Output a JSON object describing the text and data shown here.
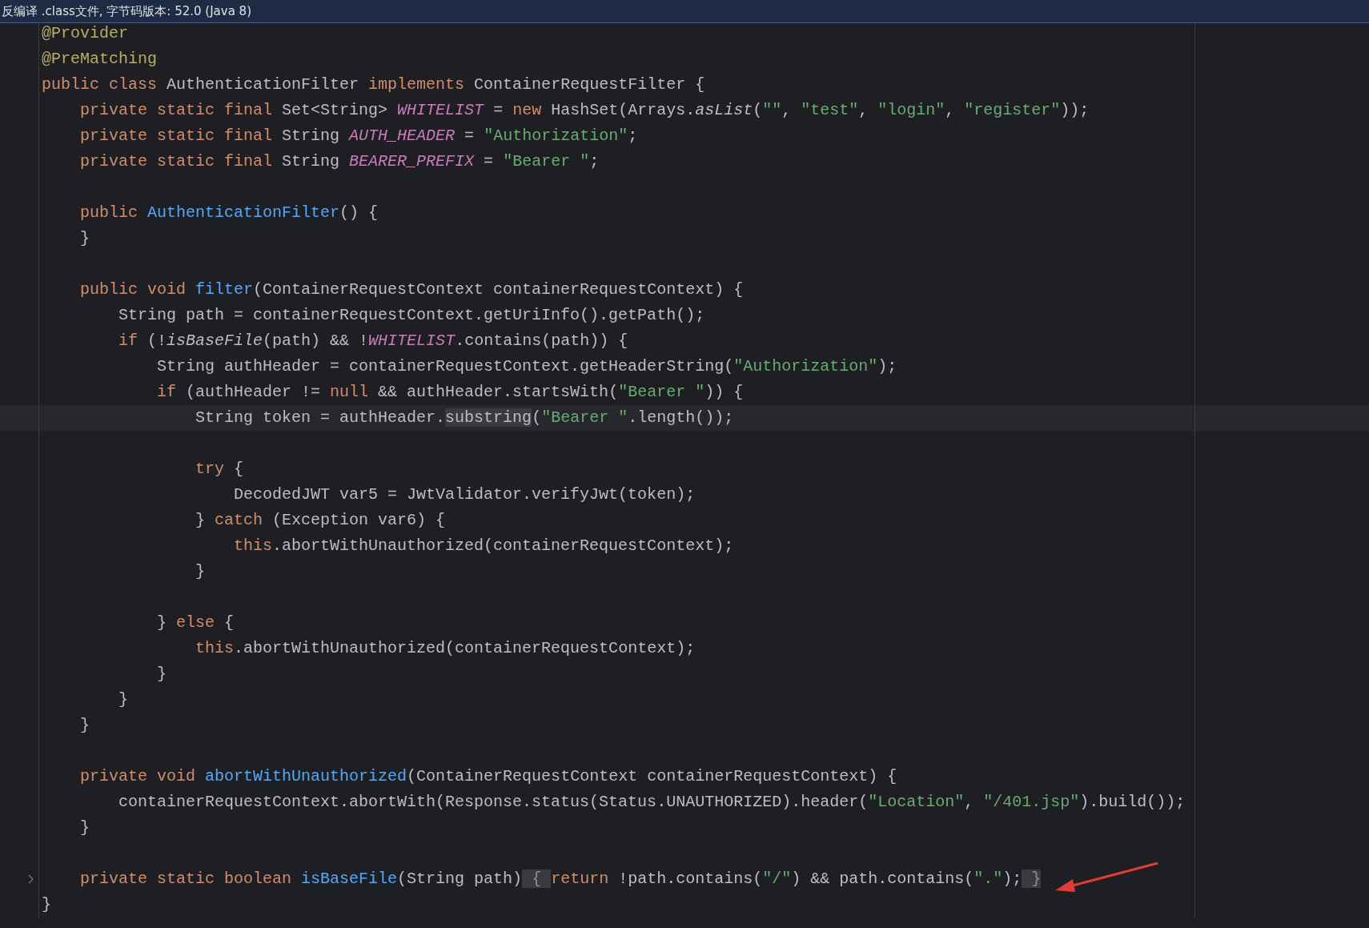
{
  "top_bar": {
    "text": "反编译 .class文件, 字节码版本: 52.0 (Java 8)"
  },
  "lines": [
    {
      "kind": "code",
      "current": false,
      "folded": false,
      "tokens": [
        {
          "kind": "annotation",
          "text": "@Provider"
        }
      ]
    },
    {
      "kind": "code",
      "current": false,
      "folded": false,
      "tokens": [
        {
          "kind": "annotation",
          "text": "@PreMatching"
        }
      ]
    },
    {
      "kind": "code",
      "current": false,
      "folded": false,
      "tokens": [
        {
          "kind": "keyword",
          "text": "public class "
        },
        {
          "kind": "plain",
          "text": "AuthenticationFilter "
        },
        {
          "kind": "keyword",
          "text": "implements "
        },
        {
          "kind": "plain",
          "text": "ContainerRequestFilter {"
        }
      ]
    },
    {
      "kind": "code",
      "current": false,
      "folded": false,
      "tokens": [
        {
          "kind": "keyword",
          "text": "    private static final "
        },
        {
          "kind": "plain",
          "text": "Set<String> "
        },
        {
          "kind": "field",
          "text": "WHITELIST"
        },
        {
          "kind": "plain",
          "text": " = "
        },
        {
          "kind": "keyword",
          "text": "new "
        },
        {
          "kind": "plain",
          "text": "HashSet(Arrays."
        },
        {
          "kind": "static",
          "text": "asList"
        },
        {
          "kind": "plain",
          "text": "("
        },
        {
          "kind": "string",
          "text": "\"\""
        },
        {
          "kind": "plain",
          "text": ", "
        },
        {
          "kind": "string",
          "text": "\"test\""
        },
        {
          "kind": "plain",
          "text": ", "
        },
        {
          "kind": "string",
          "text": "\"login\""
        },
        {
          "kind": "plain",
          "text": ", "
        },
        {
          "kind": "string",
          "text": "\"register\""
        },
        {
          "kind": "plain",
          "text": "));"
        }
      ]
    },
    {
      "kind": "code",
      "current": false,
      "folded": false,
      "tokens": [
        {
          "kind": "keyword",
          "text": "    private static final "
        },
        {
          "kind": "plain",
          "text": "String "
        },
        {
          "kind": "field",
          "text": "AUTH_HEADER"
        },
        {
          "kind": "plain",
          "text": " = "
        },
        {
          "kind": "string",
          "text": "\"Authorization\""
        },
        {
          "kind": "plain",
          "text": ";"
        }
      ]
    },
    {
      "kind": "code",
      "current": false,
      "folded": false,
      "tokens": [
        {
          "kind": "keyword",
          "text": "    private static final "
        },
        {
          "kind": "plain",
          "text": "String "
        },
        {
          "kind": "field",
          "text": "BEARER_PREFIX"
        },
        {
          "kind": "plain",
          "text": " = "
        },
        {
          "kind": "string",
          "text": "\"Bearer \""
        },
        {
          "kind": "plain",
          "text": ";"
        }
      ]
    },
    {
      "kind": "blank"
    },
    {
      "kind": "code",
      "current": false,
      "folded": false,
      "tokens": [
        {
          "kind": "keyword",
          "text": "    public "
        },
        {
          "kind": "function",
          "text": "AuthenticationFilter"
        },
        {
          "kind": "plain",
          "text": "() {"
        }
      ]
    },
    {
      "kind": "code",
      "current": false,
      "folded": false,
      "tokens": [
        {
          "kind": "plain",
          "text": "    }"
        }
      ]
    },
    {
      "kind": "blank"
    },
    {
      "kind": "code",
      "current": false,
      "folded": false,
      "tokens": [
        {
          "kind": "keyword",
          "text": "    public void "
        },
        {
          "kind": "function",
          "text": "filter"
        },
        {
          "kind": "plain",
          "text": "(ContainerRequestContext containerRequestContext) {"
        }
      ]
    },
    {
      "kind": "code",
      "current": false,
      "folded": false,
      "tokens": [
        {
          "kind": "plain",
          "text": "        String path = containerRequestContext.getUriInfo().getPath();"
        }
      ]
    },
    {
      "kind": "code",
      "current": false,
      "folded": false,
      "tokens": [
        {
          "kind": "keyword",
          "text": "        if "
        },
        {
          "kind": "plain",
          "text": "(!"
        },
        {
          "kind": "static",
          "text": "isBaseFile"
        },
        {
          "kind": "plain",
          "text": "(path) && !"
        },
        {
          "kind": "field",
          "text": "WHITELIST"
        },
        {
          "kind": "plain",
          "text": ".contains(path)) {"
        }
      ]
    },
    {
      "kind": "code",
      "current": false,
      "folded": false,
      "tokens": [
        {
          "kind": "plain",
          "text": "            String authHeader = containerRequestContext.getHeaderString("
        },
        {
          "kind": "string",
          "text": "\"Authorization\""
        },
        {
          "kind": "plain",
          "text": ");"
        }
      ]
    },
    {
      "kind": "code",
      "current": false,
      "folded": false,
      "tokens": [
        {
          "kind": "keyword",
          "text": "            if "
        },
        {
          "kind": "plain",
          "text": "(authHeader != "
        },
        {
          "kind": "keyword",
          "text": "null "
        },
        {
          "kind": "plain",
          "text": "&& authHeader.startsWith("
        },
        {
          "kind": "string",
          "text": "\"Bearer \""
        },
        {
          "kind": "plain",
          "text": ")) {"
        }
      ]
    },
    {
      "kind": "code",
      "current": true,
      "folded": false,
      "tokens": [
        {
          "kind": "plain",
          "text": "                String token = authHeader."
        },
        {
          "kind": "highlight",
          "text": "substring"
        },
        {
          "kind": "plain",
          "text": "("
        },
        {
          "kind": "string",
          "text": "\"Bearer \""
        },
        {
          "kind": "plain",
          "text": ".length());"
        }
      ]
    },
    {
      "kind": "blank"
    },
    {
      "kind": "code",
      "current": false,
      "folded": false,
      "tokens": [
        {
          "kind": "keyword",
          "text": "                try "
        },
        {
          "kind": "plain",
          "text": "{"
        }
      ]
    },
    {
      "kind": "code",
      "current": false,
      "folded": false,
      "tokens": [
        {
          "kind": "plain",
          "text": "                    DecodedJWT var5 = JwtValidator.verifyJwt(token);"
        }
      ]
    },
    {
      "kind": "code",
      "current": false,
      "folded": false,
      "tokens": [
        {
          "kind": "plain",
          "text": "                } "
        },
        {
          "kind": "keyword",
          "text": "catch "
        },
        {
          "kind": "plain",
          "text": "(Exception var6) {"
        }
      ]
    },
    {
      "kind": "code",
      "current": false,
      "folded": false,
      "tokens": [
        {
          "kind": "keyword",
          "text": "                    this"
        },
        {
          "kind": "plain",
          "text": ".abortWithUnauthorized(containerRequestContext);"
        }
      ]
    },
    {
      "kind": "code",
      "current": false,
      "folded": false,
      "tokens": [
        {
          "kind": "plain",
          "text": "                }"
        }
      ]
    },
    {
      "kind": "blank"
    },
    {
      "kind": "code",
      "current": false,
      "folded": false,
      "tokens": [
        {
          "kind": "plain",
          "text": "            } "
        },
        {
          "kind": "keyword",
          "text": "else "
        },
        {
          "kind": "plain",
          "text": "{"
        }
      ]
    },
    {
      "kind": "code",
      "current": false,
      "folded": false,
      "tokens": [
        {
          "kind": "keyword",
          "text": "                this"
        },
        {
          "kind": "plain",
          "text": ".abortWithUnauthorized(containerRequestContext);"
        }
      ]
    },
    {
      "kind": "code",
      "current": false,
      "folded": false,
      "tokens": [
        {
          "kind": "plain",
          "text": "            }"
        }
      ]
    },
    {
      "kind": "code",
      "current": false,
      "folded": false,
      "tokens": [
        {
          "kind": "plain",
          "text": "        }"
        }
      ]
    },
    {
      "kind": "code",
      "current": false,
      "folded": false,
      "tokens": [
        {
          "kind": "plain",
          "text": "    }"
        }
      ]
    },
    {
      "kind": "blank"
    },
    {
      "kind": "code",
      "current": false,
      "folded": false,
      "tokens": [
        {
          "kind": "keyword",
          "text": "    private void "
        },
        {
          "kind": "function",
          "text": "abortWithUnauthorized"
        },
        {
          "kind": "plain",
          "text": "(ContainerRequestContext containerRequestContext) {"
        }
      ]
    },
    {
      "kind": "code",
      "current": false,
      "folded": false,
      "tokens": [
        {
          "kind": "plain",
          "text": "        containerRequestContext.abortWith(Response.status(Status.UNAUTHORIZED).header("
        },
        {
          "kind": "string",
          "text": "\"Location\""
        },
        {
          "kind": "plain",
          "text": ", "
        },
        {
          "kind": "string",
          "text": "\"/401.jsp\""
        },
        {
          "kind": "plain",
          "text": ").build());"
        }
      ]
    },
    {
      "kind": "code",
      "current": false,
      "folded": false,
      "tokens": [
        {
          "kind": "plain",
          "text": "    }"
        }
      ]
    },
    {
      "kind": "blank"
    },
    {
      "kind": "code",
      "current": false,
      "folded": true,
      "tokens": [
        {
          "kind": "keyword",
          "text": "    private static boolean "
        },
        {
          "kind": "function",
          "text": "isBaseFile"
        },
        {
          "kind": "plain",
          "text": "(String path)"
        },
        {
          "kind": "fold",
          "text": " { "
        },
        {
          "kind": "keyword",
          "text": "return "
        },
        {
          "kind": "plain",
          "text": "!path.contains("
        },
        {
          "kind": "string",
          "text": "\"/\""
        },
        {
          "kind": "plain",
          "text": ") && path.contains("
        },
        {
          "kind": "string",
          "text": "\".\""
        },
        {
          "kind": "plain",
          "text": ");"
        },
        {
          "kind": "fold",
          "text": " }"
        }
      ]
    },
    {
      "kind": "code",
      "current": false,
      "folded": false,
      "tokens": [
        {
          "kind": "plain",
          "text": "}"
        }
      ]
    }
  ]
}
